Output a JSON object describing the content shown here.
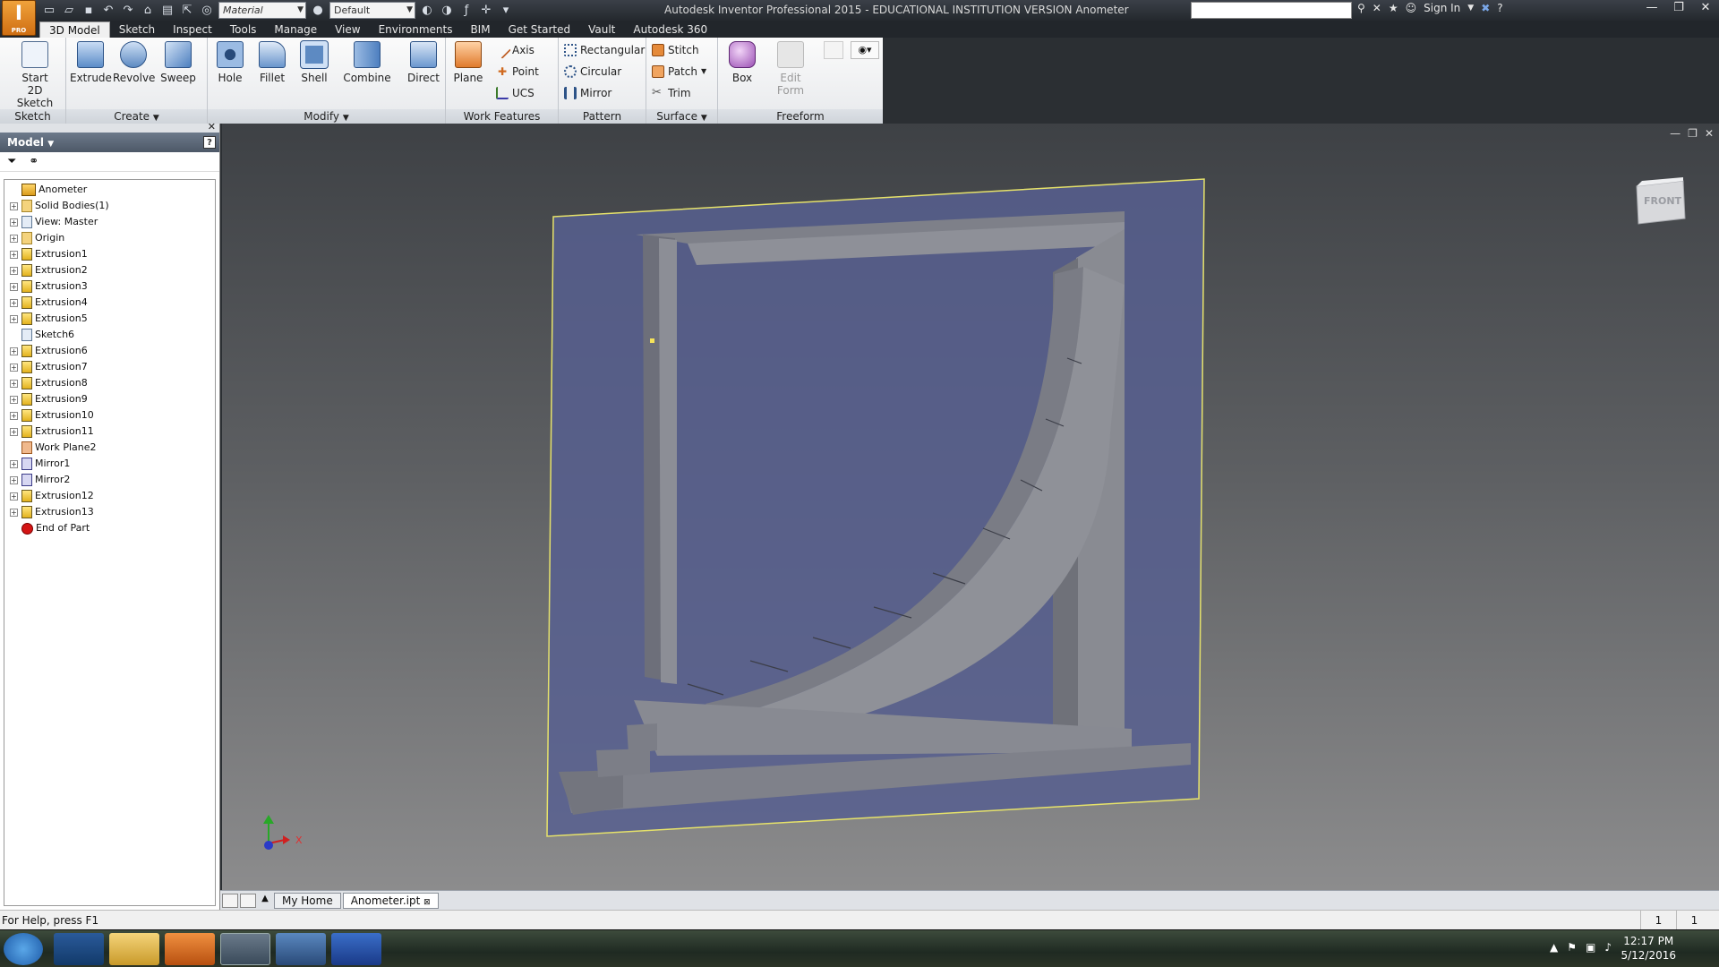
{
  "app": {
    "logo_text": "I",
    "logo_sub": "PRO",
    "title": "Autodesk Inventor Professional 2015 - EDUCATIONAL INSTITUTION VERSION   Anometer",
    "material_combo": "Material",
    "appearance_combo": "Default",
    "sign_in": "Sign In"
  },
  "menu_tabs": [
    "3D Model",
    "Sketch",
    "Inspect",
    "Tools",
    "Manage",
    "View",
    "Environments",
    "BIM",
    "Get Started",
    "Vault",
    "Autodesk 360"
  ],
  "ribbon": {
    "sketch": {
      "start_label": "Start",
      "start_label2": "2D Sketch",
      "panel": "Sketch"
    },
    "create": {
      "extrude": "Extrude",
      "revolve": "Revolve",
      "sweep": "Sweep",
      "panel": "Create"
    },
    "modify": {
      "hole": "Hole",
      "fillet": "Fillet",
      "shell": "Shell",
      "combine": "Combine",
      "direct": "Direct",
      "panel": "Modify"
    },
    "work_features": {
      "plane": "Plane",
      "axis": "Axis",
      "point": "Point",
      "ucs": "UCS",
      "panel": "Work Features"
    },
    "pattern": {
      "rectangular": "Rectangular",
      "circular": "Circular",
      "mirror": "Mirror",
      "panel": "Pattern"
    },
    "surface": {
      "stitch": "Stitch",
      "patch": "Patch",
      "trim": "Trim",
      "panel": "Surface"
    },
    "freeform": {
      "box": "Box",
      "edit_form": "Edit",
      "edit_form2": "Form",
      "panel": "Freeform"
    }
  },
  "browser": {
    "header": "Model",
    "tree": [
      {
        "label": "Anometer",
        "icon": "root",
        "expand": false
      },
      {
        "label": "Solid Bodies(1)",
        "icon": "folder",
        "expand": true
      },
      {
        "label": "View: Master",
        "icon": "sketch",
        "expand": true
      },
      {
        "label": "Origin",
        "icon": "folder",
        "expand": true
      },
      {
        "label": "Extrusion1",
        "icon": "extrude",
        "expand": true
      },
      {
        "label": "Extrusion2",
        "icon": "extrude",
        "expand": true
      },
      {
        "label": "Extrusion3",
        "icon": "extrude",
        "expand": true
      },
      {
        "label": "Extrusion4",
        "icon": "extrude",
        "expand": true
      },
      {
        "label": "Extrusion5",
        "icon": "extrude",
        "expand": true
      },
      {
        "label": "Sketch6",
        "icon": "sketch",
        "expand": false
      },
      {
        "label": "Extrusion6",
        "icon": "extrude",
        "expand": true
      },
      {
        "label": "Extrusion7",
        "icon": "extrude",
        "expand": true
      },
      {
        "label": "Extrusion8",
        "icon": "extrude",
        "expand": true
      },
      {
        "label": "Extrusion9",
        "icon": "extrude",
        "expand": true
      },
      {
        "label": "Extrusion10",
        "icon": "extrude",
        "expand": true
      },
      {
        "label": "Extrusion11",
        "icon": "extrude",
        "expand": true
      },
      {
        "label": "Work Plane2",
        "icon": "plane",
        "expand": false
      },
      {
        "label": "Mirror1",
        "icon": "mirror",
        "expand": true
      },
      {
        "label": "Mirror2",
        "icon": "mirror",
        "expand": true
      },
      {
        "label": "Extrusion12",
        "icon": "extrude",
        "expand": true
      },
      {
        "label": "Extrusion13",
        "icon": "extrude",
        "expand": true
      },
      {
        "label": "End of Part",
        "icon": "end",
        "expand": false
      }
    ]
  },
  "viewport": {
    "viewcube_face": "FRONT",
    "axis_x": "X"
  },
  "doc_tabs": [
    "My Home",
    "Anometer.ipt"
  ],
  "status": {
    "help": "For Help, press F1",
    "count1": "1",
    "count2": "1"
  },
  "taskbar": {
    "time": "12:17 PM",
    "date": "5/12/2016"
  }
}
